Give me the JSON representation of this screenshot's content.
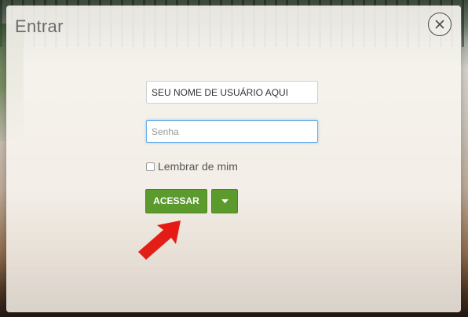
{
  "modal": {
    "title": "Entrar",
    "close_icon": "close-icon"
  },
  "form": {
    "username": {
      "value": "SEU NOME DE USUÁRIO AQUI",
      "placeholder": ""
    },
    "password": {
      "value": "",
      "placeholder": "Senha"
    },
    "remember_label": "Lembrar de mim",
    "remember_checked": false,
    "submit_label": "ACESSAR",
    "dropdown_icon": "caret-down-icon"
  },
  "annotation": {
    "icon": "red-arrow-icon",
    "color": "#e8140e"
  },
  "colors": {
    "primary_button": "#5b9a2c",
    "focus_border": "#66afe9"
  }
}
